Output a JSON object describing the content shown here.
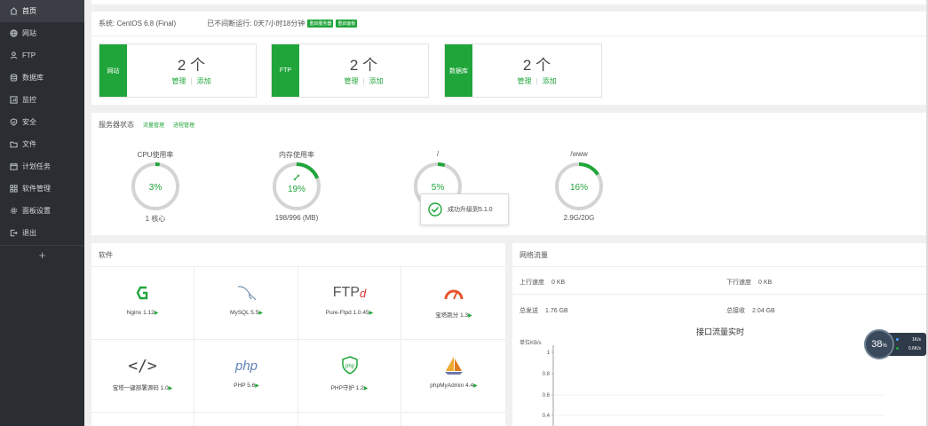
{
  "sidebar": {
    "items": [
      {
        "label": "首页",
        "icon": "home-icon",
        "active": true
      },
      {
        "label": "网站",
        "icon": "globe-icon"
      },
      {
        "label": "FTP",
        "icon": "ftp-icon"
      },
      {
        "label": "数据库",
        "icon": "database-icon"
      },
      {
        "label": "监控",
        "icon": "monitor-icon"
      },
      {
        "label": "安全",
        "icon": "shield-icon"
      },
      {
        "label": "文件",
        "icon": "folder-icon"
      },
      {
        "label": "计划任务",
        "icon": "calendar-icon"
      },
      {
        "label": "软件管理",
        "icon": "grid-icon"
      },
      {
        "label": "面板设置",
        "icon": "gear-icon"
      },
      {
        "label": "退出",
        "icon": "logout-icon"
      }
    ],
    "add_label": "+"
  },
  "system": {
    "os": "系统: CentOS 6.8 (Final)",
    "uptime": "已不间断运行: 0天7小时18分钟",
    "restart_server": "重启服务器",
    "restart_panel": "重启面板"
  },
  "stats": [
    {
      "label": "网站",
      "count": "2 个",
      "manage": "管理",
      "add": "添加"
    },
    {
      "label": "FTP",
      "count": "2 个",
      "manage": "管理",
      "add": "添加"
    },
    {
      "label": "数据库",
      "count": "2 个",
      "manage": "管理",
      "add": "添加"
    }
  ],
  "server_status": {
    "title": "服务器状态",
    "link1": "流量管理",
    "link2": "进程管理",
    "gauges": [
      {
        "title": "CPU使用率",
        "value": "3%",
        "percent": 3,
        "bottom": "1 核心"
      },
      {
        "title": "内存使用率",
        "value": "19%",
        "percent": 19,
        "bottom": "198/996 (MB)",
        "icon": "rocket-icon"
      },
      {
        "title": "/",
        "value": "5%",
        "percent": 5,
        "bottom": ""
      },
      {
        "title": "/www",
        "value": "16%",
        "percent": 16,
        "bottom": "2.9G/20G"
      }
    ]
  },
  "toast": {
    "text": "成功升级到5.1.0"
  },
  "software": {
    "title": "软件",
    "items": [
      {
        "name": "Nginx 1.12",
        "icon": "nginx-icon"
      },
      {
        "name": "MySQL 5.5",
        "icon": "mysql-icon"
      },
      {
        "name": "Pure-Ftpd 1.0.45",
        "icon": "ftp-logo-icon",
        "logo_text": "FTP"
      },
      {
        "name": "宝塔跑分 1.3",
        "icon": "speedometer-icon"
      },
      {
        "name": "宝塔一键部署源码 1.0",
        "icon": "code-icon",
        "logo_text": "</>"
      },
      {
        "name": "PHP 5.6",
        "icon": "php-icon",
        "logo_text": "php"
      },
      {
        "name": "PHP守护 1.2",
        "icon": "php-shield-icon",
        "logo_text": "php"
      },
      {
        "name": "phpMyAdmin 4.4",
        "icon": "sailboat-icon"
      }
    ],
    "arrow": "▶"
  },
  "network": {
    "title": "网络流量",
    "up_label": "上行速度",
    "up_value": "0 KB",
    "down_label": "下行速度",
    "down_value": "0 KB",
    "sent_label": "总发送",
    "sent_value": "1.76 GB",
    "recv_label": "总接收",
    "recv_value": "2.04 GB",
    "chart_title": "接口流量实时",
    "unit_label": "单位KB/s",
    "y_ticks": [
      "1",
      "0.8",
      "0.6",
      "0.4"
    ]
  },
  "floater": {
    "percent": "38",
    "percent_unit": "%",
    "up": "1K/s",
    "down": "0.6K/s"
  },
  "colors": {
    "accent": "#20a53a",
    "sidebar": "#2a2d32"
  }
}
